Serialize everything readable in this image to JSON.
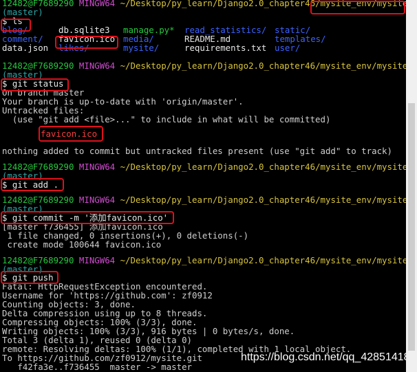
{
  "prompt": {
    "user_host": "12482@F7689290",
    "shell": "MINGW64",
    "path": "~/Desktop/py_learn/Django2.0_chapter46/mysite_env/mysite",
    "branch": "(master)"
  },
  "commands": {
    "ls": "$ ls",
    "status": "$ git status",
    "add": "$ git add .",
    "commit_prefix": "$ git commit -m '",
    "commit_msg": "添加favicon.ico",
    "commit_suffix": "'",
    "push": "$ git push"
  },
  "ls_output": {
    "row1": [
      "blog/",
      "db.sqlite3",
      "manage.py*",
      "read_statistics/",
      "static/"
    ],
    "row2": [
      "comment/",
      "favicon.ico",
      "media/",
      "README.md",
      "templates/"
    ],
    "row3": [
      "data.json",
      "likes/",
      "mysite/",
      "requirements.txt",
      "user/"
    ]
  },
  "status_output": {
    "line1": "On branch master",
    "line2": "Your branch is up-to-date with 'origin/master'.",
    "line3": "Untracked files:",
    "line4": "  (use \"git add <file>...\" to include in what will be committed)",
    "untracked": "favicon.ico",
    "line5": "nothing added to commit but untracked files present (use \"git add\" to track)"
  },
  "commit_output": {
    "line1": "[master f736455] 添加favicon.ico",
    "line2": " 1 file changed, 0 insertions(+), 0 deletions(-)",
    "line3": " create mode 100644 favicon.ico"
  },
  "push_output": [
    "Fatal: HttpRequestException encountered.",
    "Username for 'https://github.com': zf0912",
    "Counting objects: 3, done.",
    "Delta compression using up to 8 threads.",
    "Compressing objects: 100% (3/3), done.",
    "Writing objects: 100% (3/3), 916 bytes | 0 bytes/s, done.",
    "Total 3 (delta 1), reused 0 (delta 0)",
    "remote: Resolving deltas: 100% (1/1), completed with 1 local object.",
    "To https://github.com/zf0912/mysite.git",
    "   f42fa3e..f736455  master -> master"
  ],
  "watermark": "https://blog.csdn.net/qq_42851418",
  "colors": {
    "background": "#000000",
    "user_host": "#27c93f",
    "shell": "#d14bd1",
    "path": "#d8c43a",
    "branch": "#2aa7a7",
    "directory": "#3b63ff",
    "untracked": "#ff3b3b",
    "highlight_box": "#e0101a"
  }
}
